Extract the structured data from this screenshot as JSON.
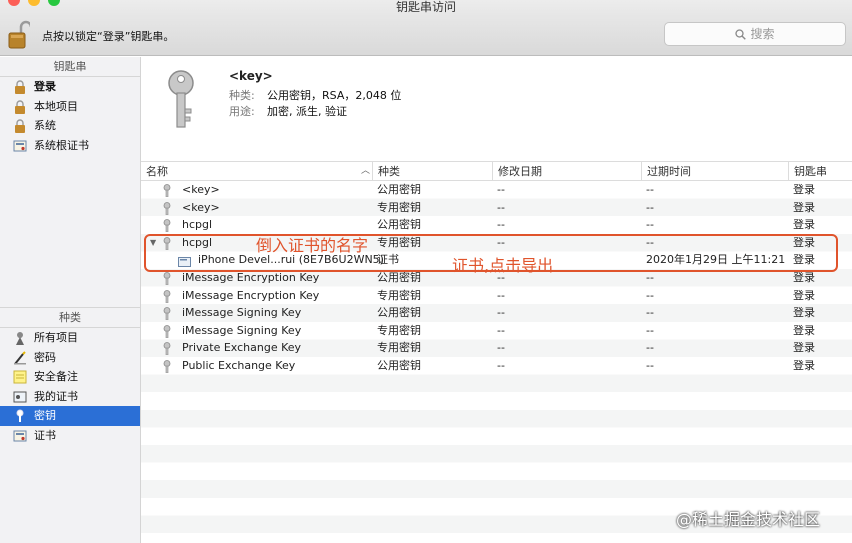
{
  "window": {
    "title": "钥匙串访问"
  },
  "toolbar": {
    "lock_text": "点按以锁定“登录”钥匙串。",
    "search_placeholder": "搜索"
  },
  "sidebar": {
    "keychains_header": "钥匙串",
    "keychains": [
      {
        "label": "登录",
        "icon": "lock-icon",
        "bold": true
      },
      {
        "label": "本地项目",
        "icon": "lock-icon"
      },
      {
        "label": "系统",
        "icon": "lock-icon"
      },
      {
        "label": "系统根证书",
        "icon": "certificate-icon"
      }
    ],
    "categories_header": "种类",
    "categories": [
      {
        "label": "所有项目",
        "icon": "all-items-icon"
      },
      {
        "label": "密码",
        "icon": "password-icon"
      },
      {
        "label": "安全备注",
        "icon": "note-icon"
      },
      {
        "label": "我的证书",
        "icon": "my-certificate-icon"
      },
      {
        "label": "密钥",
        "icon": "key-icon",
        "selected": true
      },
      {
        "label": "证书",
        "icon": "certificate-icon"
      }
    ]
  },
  "detail": {
    "name": "<key>",
    "kind_label": "种类:",
    "kind_value": "公用密钥，RSA，2,048 位",
    "usage_label": "用途:",
    "usage_value": "加密, 派生, 验证"
  },
  "table": {
    "columns": [
      "名称",
      "种类",
      "修改日期",
      "过期时间",
      "钥匙串"
    ],
    "rows": [
      {
        "name": "<key>",
        "kind": "公用密钥",
        "modified": "--",
        "expires": "--",
        "keychain": "登录",
        "icon": "key-icon"
      },
      {
        "name": "<key>",
        "kind": "专用密钥",
        "modified": "--",
        "expires": "--",
        "keychain": "登录",
        "icon": "key-icon"
      },
      {
        "name": "hcpgl",
        "kind": "公用密钥",
        "modified": "--",
        "expires": "--",
        "keychain": "登录",
        "icon": "key-icon"
      },
      {
        "name": "hcpgl",
        "kind": "专用密钥",
        "modified": "--",
        "expires": "--",
        "keychain": "登录",
        "icon": "key-icon",
        "expanded": true
      },
      {
        "name": "iPhone Devel...rui (8E7B6U2WN5)",
        "kind": "证书",
        "modified": "",
        "expires": "2020年1月29日 上午11:21:...",
        "keychain": "登录",
        "icon": "certificate-icon",
        "child": true
      },
      {
        "name": "iMessage Encryption Key",
        "kind": "公用密钥",
        "modified": "--",
        "expires": "--",
        "keychain": "登录",
        "icon": "key-icon"
      },
      {
        "name": "iMessage Encryption Key",
        "kind": "专用密钥",
        "modified": "--",
        "expires": "--",
        "keychain": "登录",
        "icon": "key-icon"
      },
      {
        "name": "iMessage Signing Key",
        "kind": "公用密钥",
        "modified": "--",
        "expires": "--",
        "keychain": "登录",
        "icon": "key-icon"
      },
      {
        "name": "iMessage Signing Key",
        "kind": "专用密钥",
        "modified": "--",
        "expires": "--",
        "keychain": "登录",
        "icon": "key-icon"
      },
      {
        "name": "Private Exchange Key",
        "kind": "专用密钥",
        "modified": "--",
        "expires": "--",
        "keychain": "登录",
        "icon": "key-icon"
      },
      {
        "name": "Public Exchange Key",
        "kind": "公用密钥",
        "modified": "--",
        "expires": "--",
        "keychain": "登录",
        "icon": "key-icon"
      }
    ]
  },
  "annotations": {
    "imported_cert_name": "倒入证书的名字",
    "cert_click_export": "证书,点击导出"
  },
  "watermark": "@稀土掘金技术社区",
  "colors": {
    "selection": "#2b6fd6",
    "annotation": "#e0542c"
  }
}
